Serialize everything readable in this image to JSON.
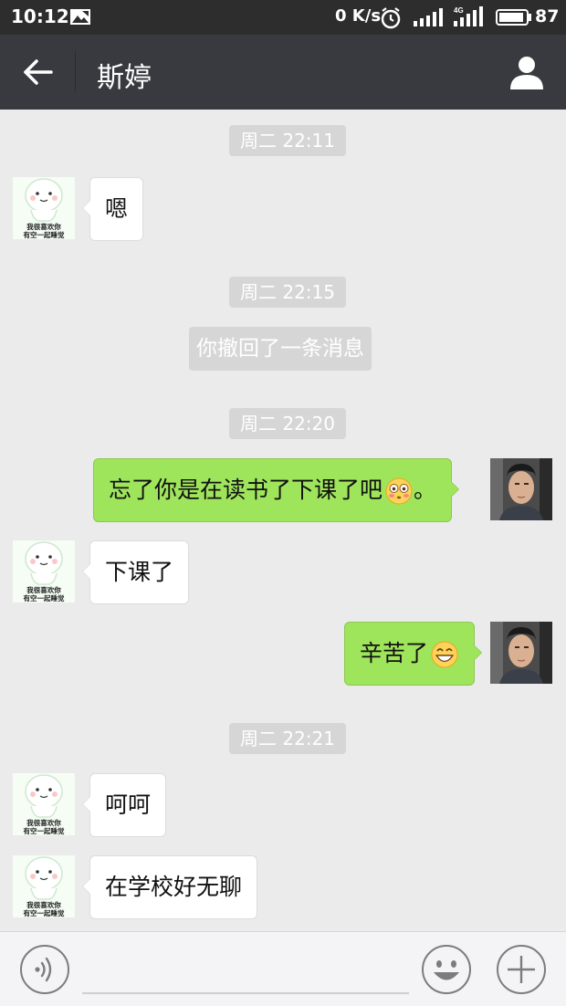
{
  "status_bar": {
    "time": "10:12",
    "net_speed": "0 K/s",
    "network": "4G",
    "battery": "87"
  },
  "header": {
    "title": "斯婷",
    "back_icon": "arrow-left-icon",
    "profile_icon": "person-icon"
  },
  "chat": {
    "timestamps": [
      "周二 22:11",
      "周二 22:15",
      "周二 22:20",
      "周二 22:21"
    ],
    "system_message": "你撤回了一条消息",
    "sticker_text": {
      "line1": "我很喜欢你",
      "line2": "有空一起睡觉"
    },
    "messages": [
      {
        "side": "left",
        "text": "嗯"
      },
      {
        "side": "right",
        "text": "忘了你是在读书了下课了吧",
        "trail": "。",
        "emoji": "flushed-face"
      },
      {
        "side": "left",
        "text": "下课了"
      },
      {
        "side": "right",
        "text": "辛苦了",
        "emoji": "grinning-face"
      },
      {
        "side": "left",
        "text": "呵呵"
      },
      {
        "side": "left",
        "text": "在学校好无聊"
      }
    ]
  },
  "bottom_bar": {
    "voice_icon": "voice-icon",
    "emoji_icon": "smiley-icon",
    "plus_icon": "plus-icon"
  },
  "colors": {
    "header": "#393a3f",
    "background": "#ebebeb",
    "sent_bubble": "#9fe55c",
    "received_bubble": "#ffffff",
    "timestamp_bg": "#d6d6d6"
  }
}
